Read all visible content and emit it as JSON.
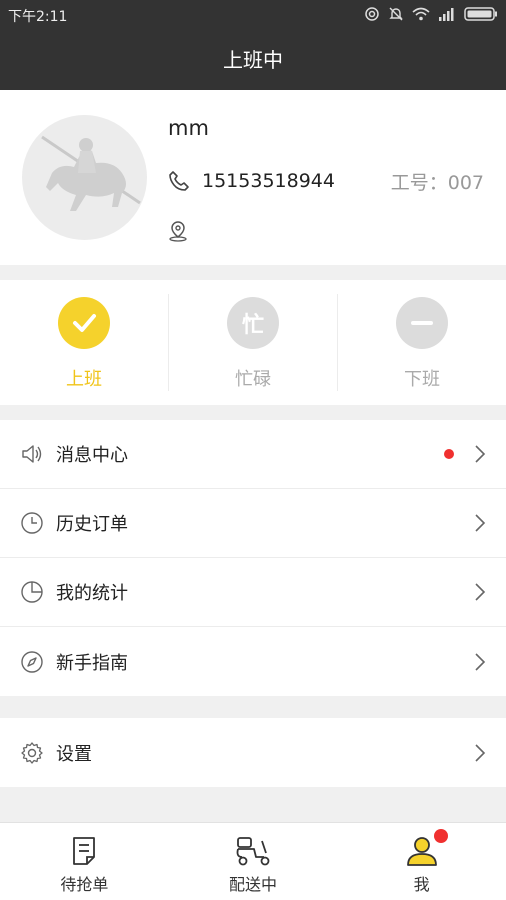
{
  "status_bar": {
    "time": "下午2:11"
  },
  "header": {
    "title": "上班中"
  },
  "profile": {
    "name": "mm",
    "phone": "15153518944",
    "employee_id": "工号：007"
  },
  "work_status": {
    "items": [
      {
        "label": "上班",
        "icon": "check-icon",
        "active": true
      },
      {
        "label": "忙碌",
        "icon": "busy-icon",
        "glyph": "忙",
        "active": false
      },
      {
        "label": "下班",
        "icon": "minus-icon",
        "active": false
      }
    ],
    "active_color": "#f5d22c"
  },
  "menu": {
    "items": [
      {
        "label": "消息中心",
        "icon": "speaker-icon",
        "has_dot": true
      },
      {
        "label": "历史订单",
        "icon": "clock-icon"
      },
      {
        "label": "我的统计",
        "icon": "pie-chart-icon"
      },
      {
        "label": "新手指南",
        "icon": "compass-icon"
      }
    ],
    "settings": {
      "label": "设置",
      "icon": "gear-icon"
    }
  },
  "bottom_nav": {
    "items": [
      {
        "label": "待抢单",
        "icon": "document-icon"
      },
      {
        "label": "配送中",
        "icon": "scooter-icon"
      },
      {
        "label": "我",
        "icon": "user-icon",
        "active": true
      }
    ]
  },
  "colors": {
    "accent": "#f5d22c",
    "header_bg": "#333333",
    "badge_red": "#f0302f"
  }
}
